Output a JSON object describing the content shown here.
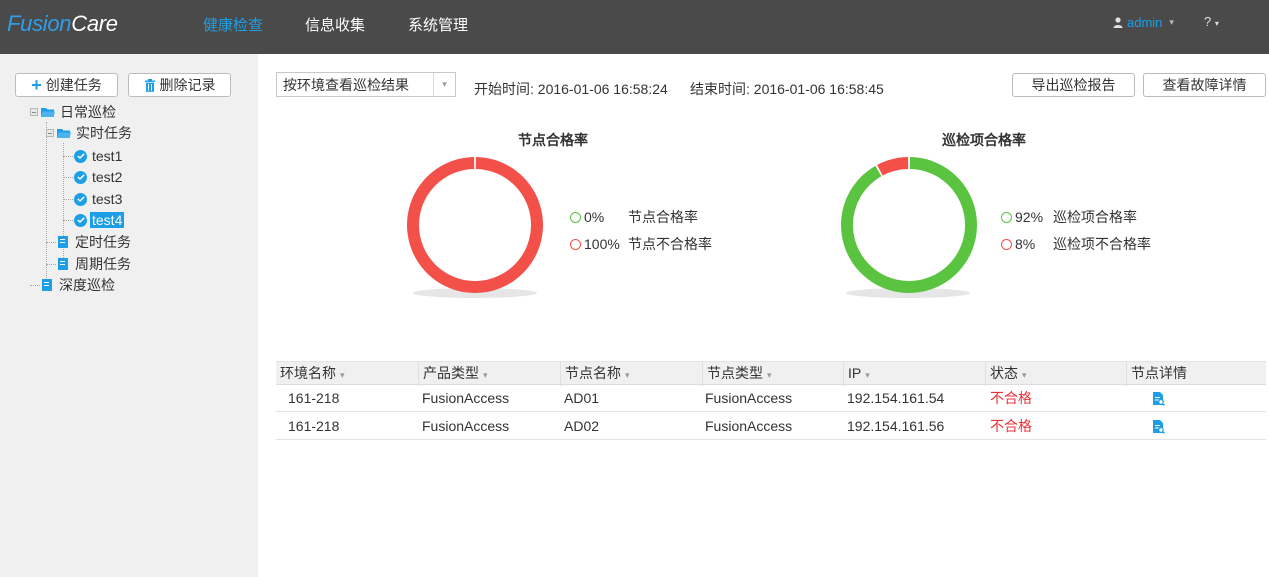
{
  "header": {
    "logo": {
      "part1": "Fusion",
      "part2": "Care"
    },
    "nav": [
      {
        "label": "健康检查",
        "active": true
      },
      {
        "label": "信息收集",
        "active": false
      },
      {
        "label": "系统管理",
        "active": false
      }
    ],
    "user": {
      "name": "admin",
      "icon": "user-icon"
    },
    "help": {
      "label": "?"
    }
  },
  "sidebar": {
    "create_button": "创建任务",
    "delete_button": "删除记录",
    "tree": {
      "daily": "日常巡检",
      "realtime": "实时任务",
      "tasks": [
        "test1",
        "test2",
        "test3",
        "test4"
      ],
      "selected_task": "test4",
      "scheduled": "定时任务",
      "periodic": "周期任务",
      "deep": "深度巡检"
    }
  },
  "toolbar": {
    "view_select": "按环境查看巡检结果",
    "start_time": "开始时间: 2016-01-06 16:58:24",
    "end_time": "结束时间: 2016-01-06 16:58:45",
    "export_button": "导出巡检报告",
    "fault_button": "查看故障详情"
  },
  "charts": {
    "node": {
      "title": "节点合格率",
      "legend": [
        {
          "pct": "0%",
          "label": "节点合格率"
        },
        {
          "pct": "100%",
          "label": "节点不合格率"
        }
      ]
    },
    "item": {
      "title": "巡检项合格率",
      "legend": [
        {
          "pct": "92%",
          "label": "巡检项合格率"
        },
        {
          "pct": "8%",
          "label": "巡检项不合格率"
        }
      ]
    }
  },
  "chart_data": [
    {
      "type": "pie",
      "title": "节点合格率",
      "categories": [
        "节点合格率",
        "节点不合格率"
      ],
      "values": [
        0,
        100
      ],
      "colors": [
        "#5ac440",
        "#f4504a"
      ]
    },
    {
      "type": "pie",
      "title": "巡检项合格率",
      "categories": [
        "巡检项合格率",
        "巡检项不合格率"
      ],
      "values": [
        92,
        8
      ],
      "colors": [
        "#5ac440",
        "#f4504a"
      ]
    }
  ],
  "colors": {
    "pass": "#5ac440",
    "fail": "#f4504a",
    "accent": "#1c9fe7",
    "header_bg": "#4a4a4a"
  },
  "table": {
    "columns": [
      "环境名称",
      "产品类型",
      "节点名称",
      "节点类型",
      "IP",
      "状态",
      "节点详情"
    ],
    "rows": [
      {
        "env": "161-218",
        "product": "FusionAccess",
        "node": "AD01",
        "node_type": "FusionAccess",
        "ip": "192.154.161.54",
        "status": "不合格"
      },
      {
        "env": "161-218",
        "product": "FusionAccess",
        "node": "AD02",
        "node_type": "FusionAccess",
        "ip": "192.154.161.56",
        "status": "不合格"
      }
    ]
  }
}
